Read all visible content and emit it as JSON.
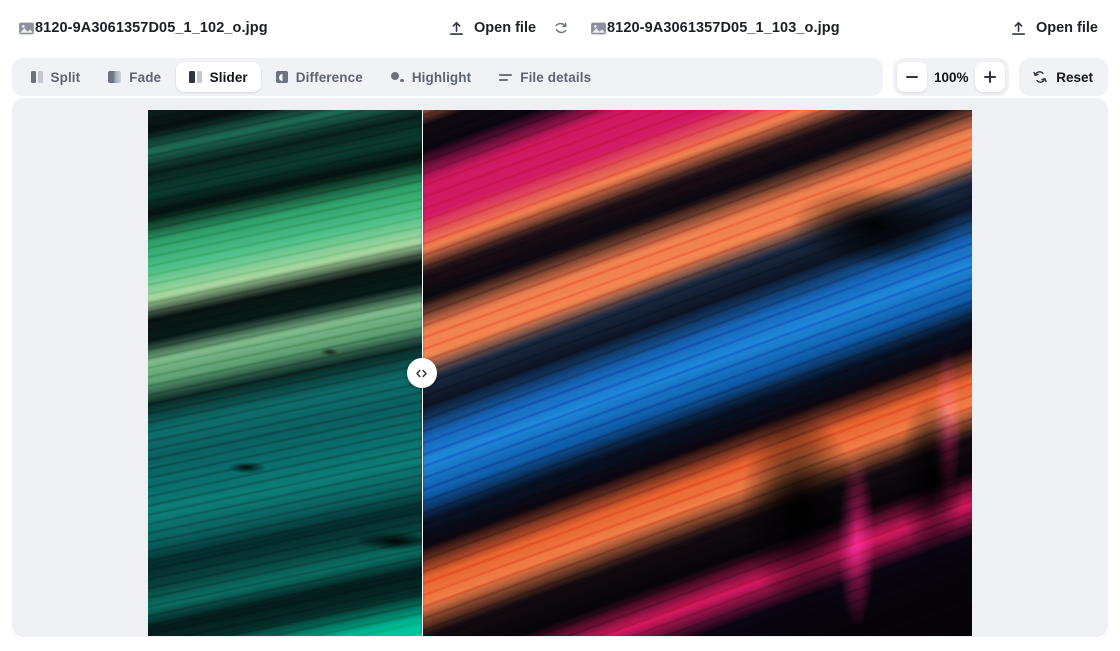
{
  "header": {
    "left_file": {
      "icon": "image-icon",
      "name": "8120-9A3061357D05_1_102_o.jpg"
    },
    "right_file": {
      "icon": "image-icon",
      "name": "8120-9A3061357D05_1_103_o.jpg"
    },
    "open_file_left": {
      "icon": "upload-icon",
      "label": "Open file"
    },
    "open_file_right": {
      "icon": "upload-icon",
      "label": "Open file"
    },
    "swap_icon": "swap-arrow-icon"
  },
  "toolbar": {
    "tabs": [
      {
        "id": "split",
        "label": "Split",
        "icon": "split-bars-icon",
        "active": false
      },
      {
        "id": "fade",
        "label": "Fade",
        "icon": "fade-gradient-icon",
        "active": false
      },
      {
        "id": "slider",
        "label": "Slider",
        "icon": "slider-bars-icon",
        "active": true
      },
      {
        "id": "difference",
        "label": "Difference",
        "icon": "difference-icon",
        "active": false
      },
      {
        "id": "highlight",
        "label": "Highlight",
        "icon": "highlight-dots-icon",
        "active": false
      },
      {
        "id": "file-details",
        "label": "File details",
        "icon": "lines-icon",
        "active": false
      }
    ],
    "zoom": {
      "decrease_icon": "minus-icon",
      "increase_icon": "plus-icon",
      "value": "100%"
    },
    "reset": {
      "icon": "refresh-icon",
      "label": "Reset"
    }
  },
  "viewer": {
    "mode": "slider",
    "divider_position_percent": 33.25,
    "handle_icon": "left-right-chevron-icon",
    "background_color": "#eff0f3",
    "left_image_alt": "Teal and green marbled acrylic paint swirls",
    "right_image_alt": "Crimson, coral, black and blue marbled acrylic paint swirls"
  }
}
